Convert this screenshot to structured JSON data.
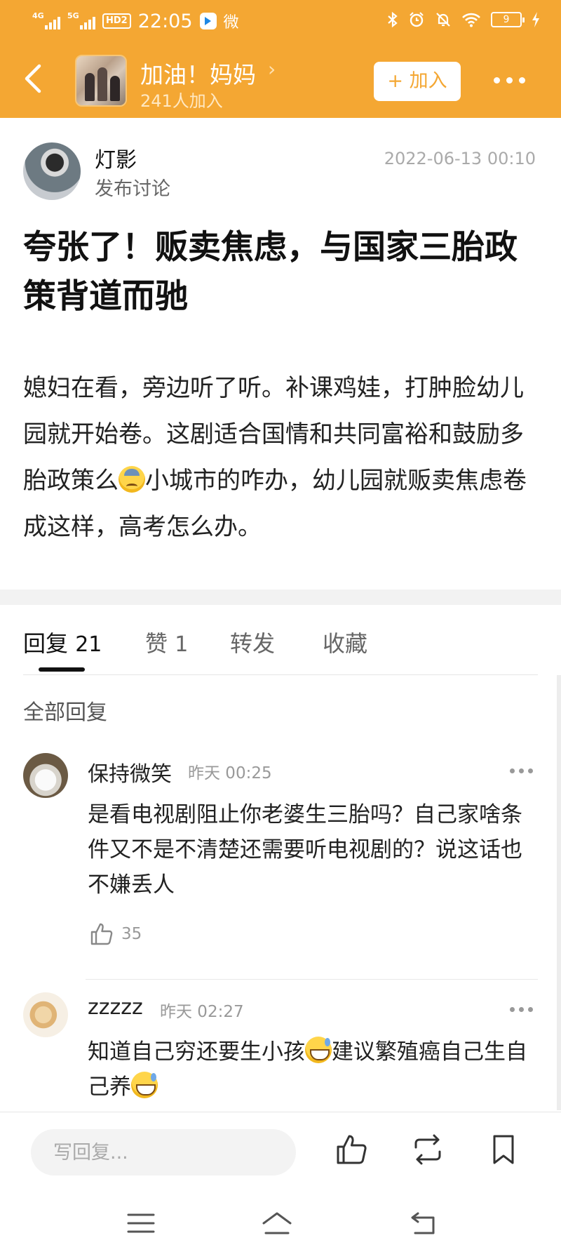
{
  "status_bar": {
    "net1": "4G",
    "net2": "5G",
    "hd": "HD2",
    "time": "22:05",
    "weibo": "微",
    "battery": "9"
  },
  "header": {
    "back_label": "返回",
    "group_name": "加油！妈妈",
    "member_count": "241人加入",
    "join_label": "+ 加入"
  },
  "post": {
    "author_name": "灯影",
    "author_action": "发布讨论",
    "time": "2022-06-13 00:10",
    "title": "夸张了！贩卖焦虑，与国家三胎政策背道而驰",
    "body_part1": "媳妇在看，旁边听了听。补课鸡娃，打肿脸幼儿园就开始卷。这剧适合国情和共同富裕和鼓励多胎政策么",
    "body_part2": "小城市的咋办，幼儿园就贩卖焦虑卷成这样，高考怎么办。"
  },
  "tabs": [
    {
      "label": "回复",
      "count": "21"
    },
    {
      "label": "赞",
      "count": "1"
    },
    {
      "label": "转发",
      "count": ""
    },
    {
      "label": "收藏",
      "count": ""
    }
  ],
  "section_title": "全部回复",
  "comments": [
    {
      "name": "保持微笑",
      "time": "昨天 00:25",
      "text": "是看电视剧阻止你老婆生三胎吗？自己家啥条件又不是不清楚还需要听电视剧的？说这话也不嫌丢人",
      "likes": "35"
    },
    {
      "name": "zzzzz",
      "time": "昨天 02:27",
      "text_part1": "知道自己穷还要生小孩",
      "text_part2": "建议繁殖癌自己生自己养"
    }
  ],
  "bottom_bar": {
    "reply_placeholder": "写回复..."
  },
  "colors": {
    "brand": "#f4a733"
  }
}
